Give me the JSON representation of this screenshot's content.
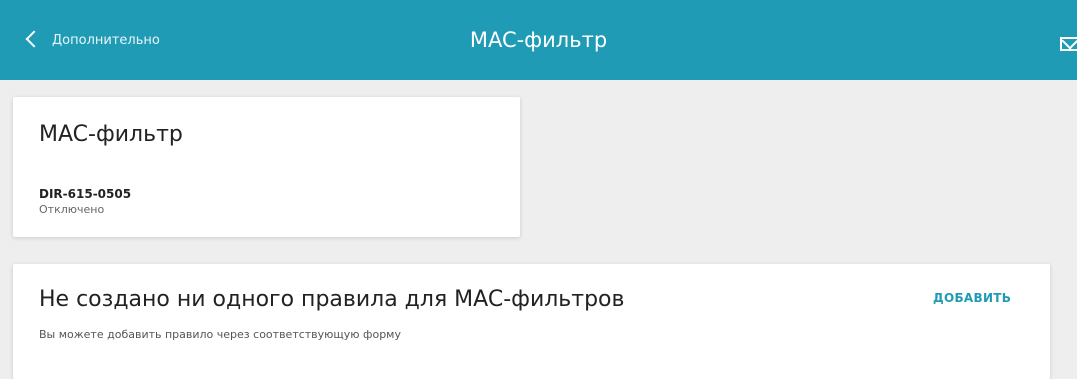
{
  "header": {
    "back_label": "Дополнительно",
    "title": "MAC-фильтр",
    "icons": {
      "back": "chevron-left-icon",
      "notifications": "envelope-icon"
    },
    "colors": {
      "background": "#1f9bb5",
      "text": "#ffffff"
    }
  },
  "summary_card": {
    "title": "MAC-фильтр",
    "device_name": "DIR-615-0505",
    "status": "Отключено"
  },
  "rules_card": {
    "title": "Не создано ни одного правила для MAC-фильтров",
    "hint": "Вы можете добавить правило через соответствующую форму",
    "add_label": "ДОБАВИТЬ",
    "colors": {
      "accent": "#1f9bb5"
    }
  }
}
